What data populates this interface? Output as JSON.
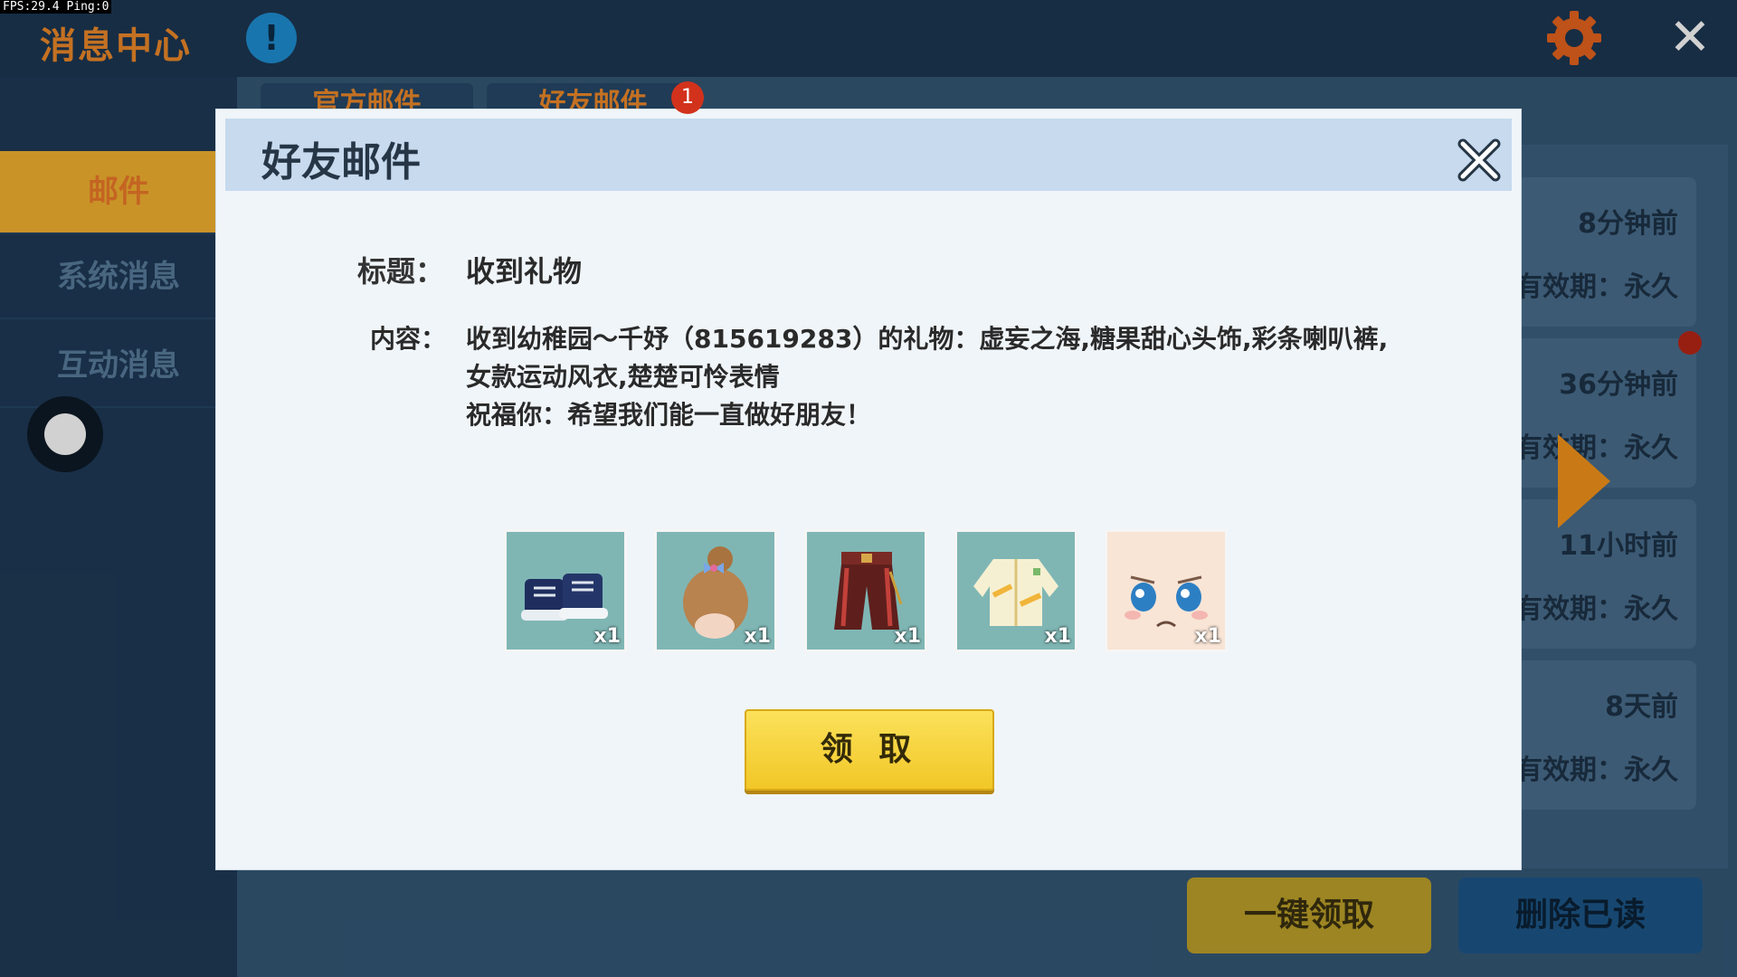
{
  "status": {
    "fps_text": "FPS:29.4  Ping:0"
  },
  "app": {
    "title": "消息中心",
    "info_glyph": "!",
    "close_glyph": "✕"
  },
  "sidebar": {
    "items": [
      {
        "label": "邮件",
        "active": true
      },
      {
        "label": "系统消息",
        "active": false
      },
      {
        "label": "互动消息",
        "active": false
      }
    ]
  },
  "tabs": [
    {
      "label": "官方邮件"
    },
    {
      "label": "好友邮件",
      "badge": "1"
    }
  ],
  "mail_list": [
    {
      "time": "8分钟前",
      "expiry": "有效期：永久"
    },
    {
      "time": "36分钟前",
      "expiry": "有效期：永久"
    },
    {
      "time": "11小时前",
      "expiry": "有效期：永久"
    },
    {
      "time": "8天前",
      "expiry": "有效期：永久"
    }
  ],
  "footer": {
    "claim_all": "一键领取",
    "delete_read": "删除已读"
  },
  "dialog": {
    "title": "好友邮件",
    "subject_label": "标题：",
    "subject": "收到礼物",
    "content_label": "内容：",
    "content_line1": "收到幼稚园～千妤（815619283）的礼物：虚妄之海,糖果甜心头饰,彩条喇叭裤,",
    "content_line2": "女款运动风衣,楚楚可怜表情",
    "content_line3": "祝福你：希望我们能一直做好朋友！",
    "items": [
      {
        "icon": "sneakers-icon",
        "qty": "x1"
      },
      {
        "icon": "hair-bow-icon",
        "qty": "x1"
      },
      {
        "icon": "striped-pants-icon",
        "qty": "x1"
      },
      {
        "icon": "sport-jacket-icon",
        "qty": "x1"
      },
      {
        "icon": "pitiful-face-icon",
        "qty": "x1"
      }
    ],
    "claim_button": "领 取"
  },
  "colors": {
    "accent_orange": "#f08a2a",
    "claim_yellow": "#f6cf33",
    "header_blue": "#c7daee"
  }
}
